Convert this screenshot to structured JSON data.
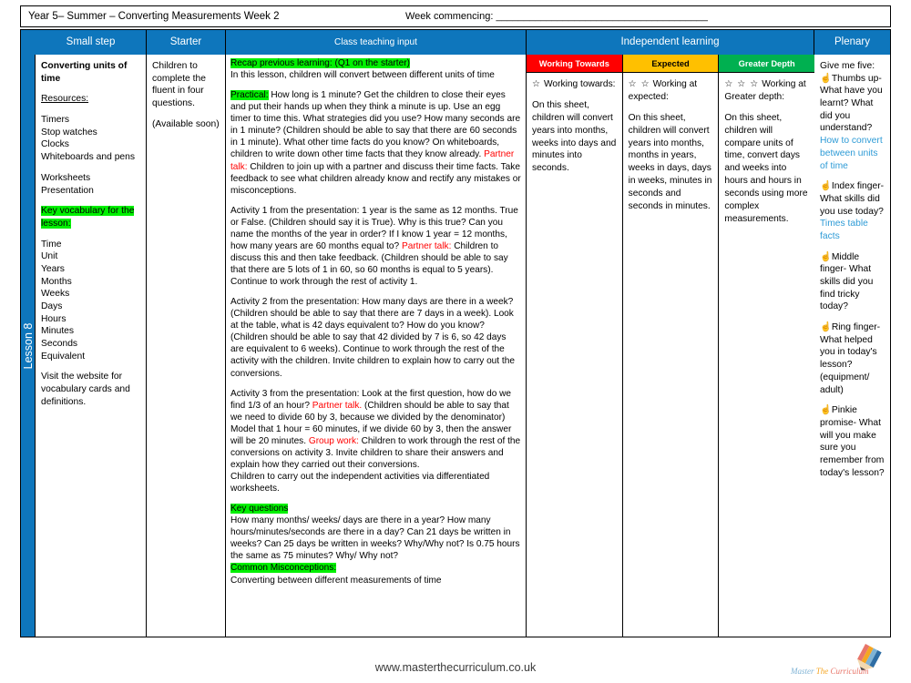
{
  "header": {
    "title": "Year 5– Summer – Converting Measurements  Week 2",
    "week_commencing": "Week commencing: ______________________________________"
  },
  "columns": {
    "small_step": "Small step",
    "starter": "Starter",
    "class_teaching_input": "Class teaching input",
    "independent_learning": "Independent learning",
    "plenary": "Plenary"
  },
  "lesson_tab": "Lesson 8",
  "small_step": {
    "heading": "Converting units of time",
    "resources_label": "Resources:",
    "resources": "Timers\nStop watches\nClocks\nWhiteboards and pens",
    "resources2": "Worksheets\nPresentation",
    "key_vocab_label": "Key vocabulary for the lesson:",
    "vocabulary": "Time\nUnit\nYears\nMonths\nWeeks\nDays\nHours\nMinutes\nSeconds\nEquivalent",
    "website_note": "Visit the website for vocabulary cards and definitions."
  },
  "starter": {
    "text": "Children to complete the fluent in four questions.",
    "note": "(Available soon)"
  },
  "teaching": {
    "recap_label": "Recap previous learning: (Q1 on the starter)",
    "recap_text": "In this lesson, children will convert between different units of time",
    "practical_label": "Practical:",
    "practical_text_1": " How long is 1 minute? Get the children to close their eyes and put their hands up when they think a minute is up. Use an egg timer to time this. What strategies did you use? How many seconds are in 1 minute? (Children should be able to say that there are 60 seconds in 1 minute). What other time facts do you know?  On whiteboards, children to write down other time facts that they know already. ",
    "partner_talk_1": "Partner talk:",
    "practical_text_2": " Children to join up with a partner and discuss their time facts. Take feedback to see what children already know and rectify any mistakes or misconceptions.",
    "activity1_a": "Activity 1 from the presentation: 1 year is the same as 12 months. True or False. (Children should say it is True). Why is this true? Can you name the months of the year in order? If I know 1 year = 12 months, how many years are 60 months equal to? ",
    "partner_talk_2": "Partner talk:",
    "activity1_b": " Children to discuss this and then take feedback. (Children should be able to say that there are 5 lots of 1 in 60, so 60 months is equal to 5 years). Continue to work through the rest of activity 1.",
    "activity2": "Activity 2 from the presentation: How many days are there in a week? (Children should be able to say that there are 7 days in a week). Look at the table, what is 42 days equivalent to? How do you know? (Children should be able to say that 42 divided by 7 is 6, so 42 days are equivalent to 6 weeks). Continue to work through the rest of the activity with the children. Invite children to explain how to carry out the conversions.",
    "activity3_a": "Activity 3 from the presentation: Look at the first question, how do we find 1/3 of an hour? ",
    "partner_talk_3": "Partner talk.",
    "activity3_b": " (Children should be able to say that we need to divide 60 by 3, because we divided by the denominator) Model that 1 hour = 60 minutes, if we divide 60 by 3, then the answer will be 20 minutes. ",
    "group_work_label": "Group work:",
    "activity3_c": " Children to work through the rest of the conversions on activity 3. Invite children to share their answers and explain how they carried out their conversions.",
    "activity3_d": "Children to carry out the independent activities via differentiated worksheets.",
    "key_questions_label": "Key questions",
    "key_questions_text": "How many months/ weeks/ days are there in a year? How many hours/minutes/seconds are there in a day? Can 21 days be written in weeks? Can 25 days be written in weeks? Why/Why not? Is 0.75 hours the same as 75 minutes? Why/ Why not?",
    "misconceptions_label": "Common Misconceptions:",
    "misconceptions_text": "Converting between different measurements of time"
  },
  "independent": [
    {
      "header": "Working Towards",
      "header_color": "#FF0000",
      "stars": "☆",
      "subtitle": "Working towards:",
      "body": "On this sheet, children will convert years into months, weeks into days and minutes into seconds."
    },
    {
      "header": "Expected",
      "header_color": "#FFC000",
      "stars": "☆ ☆",
      "subtitle": "Working at expected:",
      "body": "On this sheet, children will convert years into months, months in years, weeks in days, days in weeks, minutes in seconds and seconds in minutes."
    },
    {
      "header": "Greater Depth",
      "header_color": "#00B050",
      "stars": "☆ ☆ ☆",
      "subtitle": "Working at Greater depth:",
      "body": "On this sheet, children will compare units of time, convert days and weeks into hours and hours in seconds using more complex measurements."
    }
  ],
  "plenary": {
    "intro": "Give me five:",
    "items": [
      {
        "prompt": "Thumbs up- What have you learnt? What did you understand?",
        "answer": "How to convert between units of time"
      },
      {
        "prompt": "Index finger- What skills did you use today?",
        "answer": "Times table facts"
      },
      {
        "prompt": "Middle finger- What skills did you find tricky today?",
        "answer": ""
      },
      {
        "prompt": "Ring finger- What helped you in today's lesson? (equipment/ adult)",
        "answer": ""
      },
      {
        "prompt": "Pinkie promise- What will you make sure you remember from today's lesson?",
        "answer": ""
      }
    ]
  },
  "footer": {
    "website": "www.masterthecurriculum.co.uk",
    "logo_word_1": "Master",
    "logo_word_2": "The",
    "logo_word_3": "Curriculum"
  }
}
